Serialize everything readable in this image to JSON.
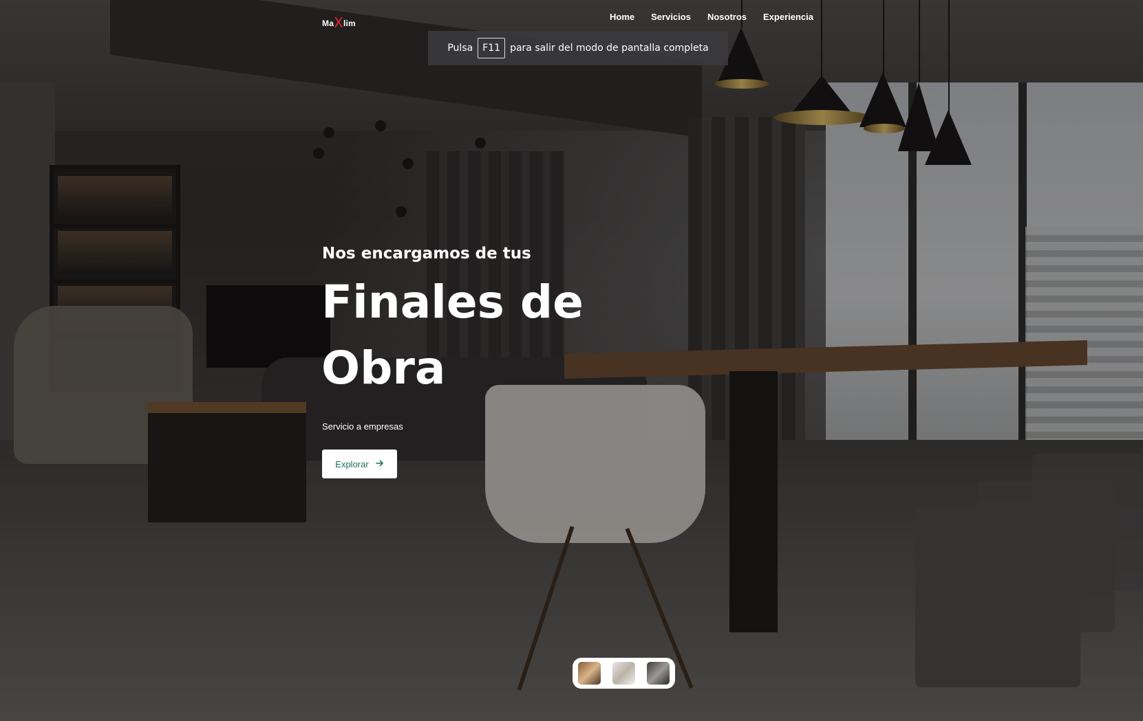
{
  "nav": {
    "logo_prefix": "Ma",
    "logo_mark": "X",
    "logo_suffix": "lim",
    "links": [
      "Home",
      "Servicios",
      "Nosotros",
      "Experiencia"
    ]
  },
  "fullscreen_toast": {
    "before": "Pulsa",
    "key": "F11",
    "after": "para salir del modo de pantalla completa"
  },
  "hero": {
    "subtitle": "Nos encargamos de tus",
    "title_line1": "Finales de",
    "title_line2": "Obra",
    "tagline": "Servicio a empresas",
    "button_label": "Explorar",
    "button_icon": "arrow-right-icon"
  },
  "colors": {
    "accent_green": "#1d6f5e",
    "logo_red": "#e0262a"
  },
  "thumbnails": [
    {
      "name": "slide-thumbnail-1",
      "icon": "interior-photo"
    },
    {
      "name": "slide-thumbnail-2",
      "icon": "interior-photo"
    },
    {
      "name": "slide-thumbnail-3",
      "icon": "interior-photo"
    }
  ]
}
